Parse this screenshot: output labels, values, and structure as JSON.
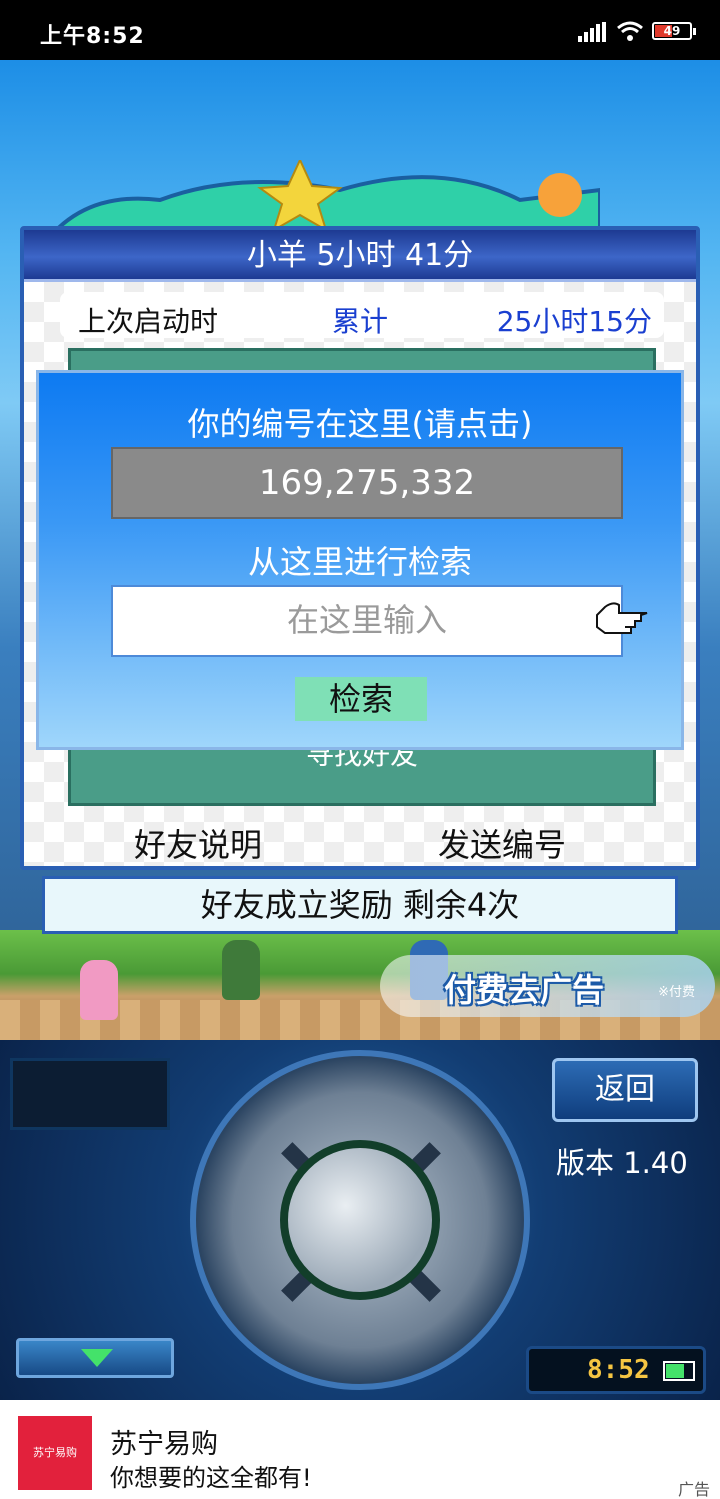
{
  "status_bar": {
    "time": "上午8:52",
    "battery": "49"
  },
  "friend_panel": {
    "header_title": "小羊  5小时 41分",
    "last_start_label": "上次启动时",
    "total_label": "累计",
    "total_time": "25小时15分",
    "find_friend_label": "寻找好友",
    "friend_note_label": "好友说明",
    "send_id_label": "发送编号"
  },
  "reward_bar": {
    "text": "好友成立奖励  剩余4次"
  },
  "number_dialog": {
    "your_id_prompt": "你的编号在这里(请点击)",
    "your_id": "169,275,332",
    "search_prompt": "从这里进行检索",
    "search_placeholder": "在这里输入",
    "search_button": "检索"
  },
  "scene": {
    "remove_ads_label": "付费去广告",
    "remove_ads_sub": "※付费"
  },
  "controls": {
    "back_button": "返回",
    "version": "版本 1.40",
    "clock": "8:52"
  },
  "ad": {
    "logo_text": "苏宁易购",
    "brand": "苏宁易购",
    "slogan": "你想要的这全都有!",
    "ad_tag": "广告"
  },
  "colors": {
    "panel_border": "#2a5fb4",
    "dialog_blue": "#0d7af2",
    "search_button_bg": "#7fe0b6",
    "link_blue": "#1a3fd0"
  }
}
